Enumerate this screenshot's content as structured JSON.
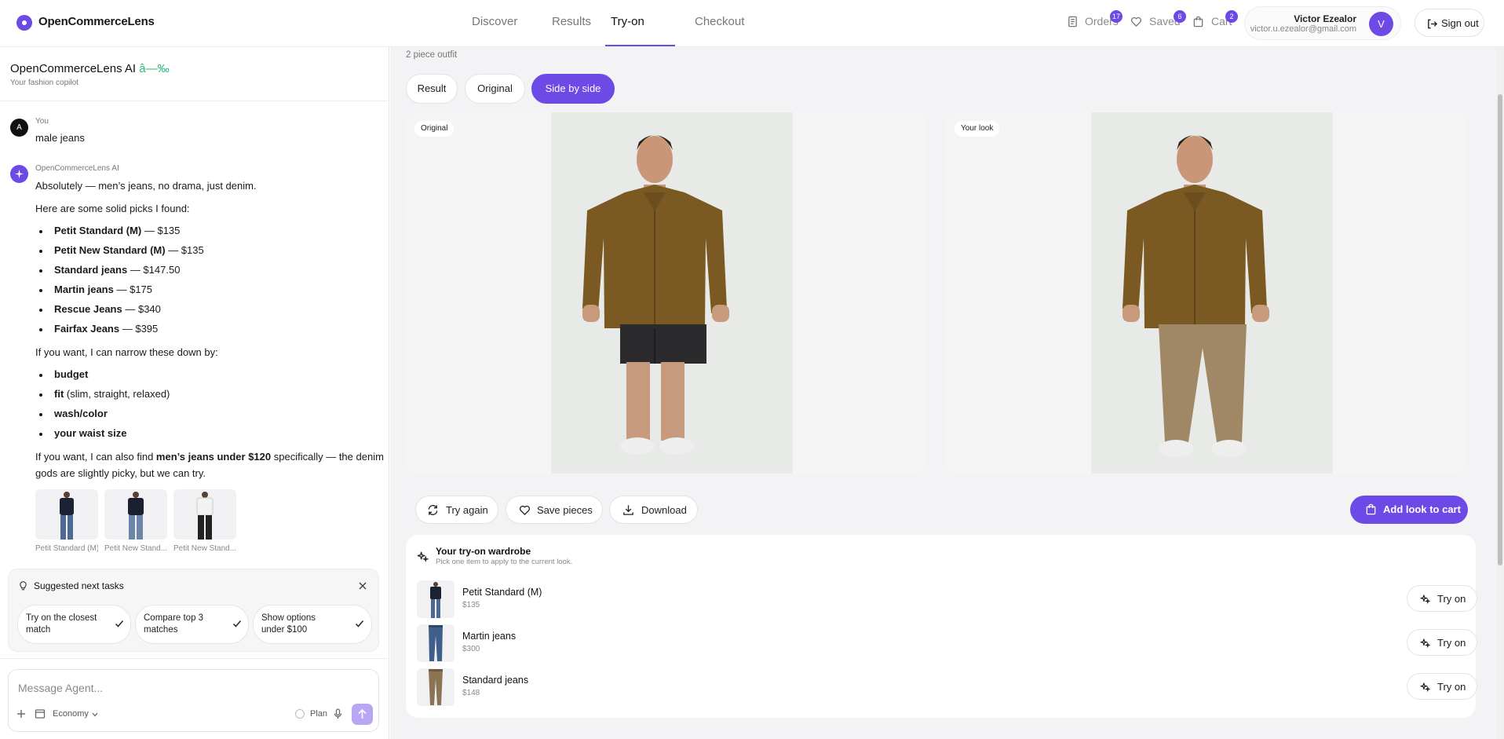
{
  "app": {
    "brand": "OpenCommerceLens"
  },
  "nav": {
    "tabs": [
      "Discover",
      "Results",
      "Try-on",
      "Checkout"
    ],
    "active": "Try-on"
  },
  "header": {
    "orders_label": "Orders",
    "orders_count": "17",
    "saved_label": "Saved",
    "saved_count": "6",
    "cart_label": "Cart",
    "cart_count": "2",
    "user_name": "Victor Ezealor",
    "user_email": "victor.u.ezealor@gmail.com",
    "user_initial": "V",
    "sign_out": "Sign out"
  },
  "sidebar": {
    "title": "OpenCommerceLens AI",
    "title_suffix": "â—‰",
    "subtitle": "Your fashion copilot",
    "user_msg": {
      "avatar": "A",
      "who": "You",
      "text": "male jeans"
    },
    "ai_msg": {
      "who": "OpenCommerceLens AI",
      "intro": "Absolutely — men’s jeans, no drama, just denim.",
      "picks_intro": "Here are some solid picks I found:",
      "picks": [
        {
          "name": "Petit Standard (M)",
          "price": " — $135"
        },
        {
          "name": "Petit New Standard (M)",
          "price": " — $135"
        },
        {
          "name": "Standard jeans",
          "price": " — $147.50"
        },
        {
          "name": "Martin jeans",
          "price": " — $175"
        },
        {
          "name": "Rescue Jeans",
          "price": " — $340"
        },
        {
          "name": "Fairfax Jeans",
          "price": " — $395"
        }
      ],
      "narrow_intro": "If you want, I can narrow these down by:",
      "narrow": [
        {
          "name": "budget",
          "rest": ""
        },
        {
          "name": "fit",
          "rest": " (slim, straight, relaxed)"
        },
        {
          "name": "wash/color",
          "rest": ""
        },
        {
          "name": "your waist size",
          "rest": ""
        }
      ],
      "closing_a": "If you want, I can also find ",
      "closing_bold": "men’s jeans under $120",
      "closing_b": " specifically — the denim",
      "closing_c": "gods are slightly picky, but we can try.",
      "thumbs": [
        "Petit Standard (M)",
        "Petit New Stand...",
        "Petit New Stand..."
      ]
    },
    "suggestions": {
      "title": "Suggested next tasks",
      "items": [
        "Try on the closest match",
        "Compare top 3 matches",
        "Show options under $100"
      ]
    },
    "composer": {
      "placeholder": "Message Agent...",
      "model": "Economy",
      "plan": "Plan"
    }
  },
  "main": {
    "outfit_label": "2 piece outfit",
    "views": [
      "Result",
      "Original",
      "Side by side"
    ],
    "active_view": "Side by side",
    "original_tag": "Original",
    "result_tag": "Your look",
    "actions": {
      "try_again": "Try again",
      "save": "Save pieces",
      "download": "Download",
      "add_to_cart": "Add look to cart"
    },
    "wardrobe": {
      "title": "Your try-on wardrobe",
      "subtitle": "Pick one item to apply to the current look.",
      "items": [
        {
          "name": "Petit Standard (M)",
          "price": "$135",
          "button": "Try on"
        },
        {
          "name": "Martin jeans",
          "price": "$300",
          "button": "Try on"
        },
        {
          "name": "Standard jeans",
          "price": "$148",
          "button": "Try on"
        }
      ]
    }
  },
  "colors": {
    "accent": "#6d4ae6",
    "jacket": "#7a5a22",
    "chino": "#a08766",
    "denim": "#3f5f8a"
  }
}
